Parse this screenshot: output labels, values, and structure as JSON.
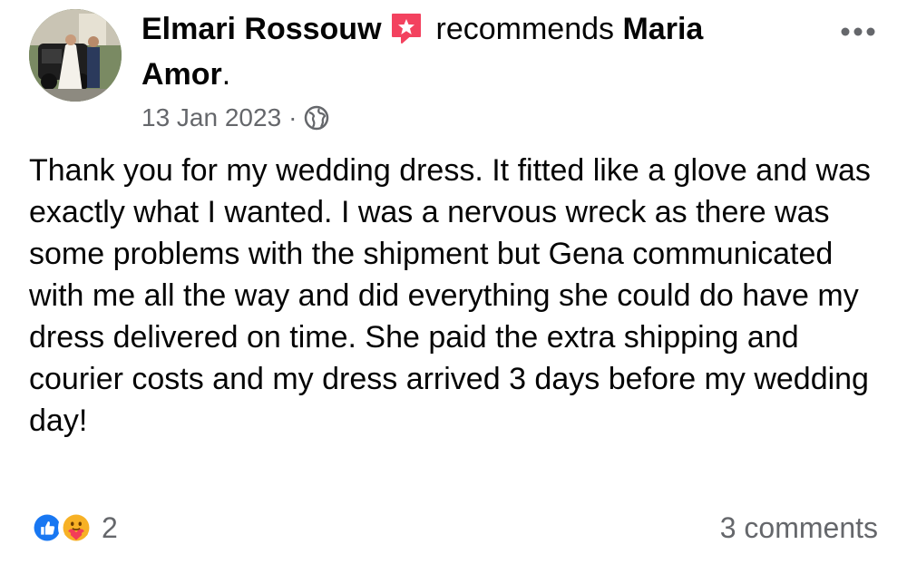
{
  "post": {
    "author": "Elmari Rossouw",
    "action": "recommends",
    "page_name_part1": "Maria",
    "page_name_part2": "Amor",
    "page_name_suffix": ".",
    "date": "13 Jan 2023",
    "separator": "·",
    "audience_icon": "globe-icon",
    "badge_icon": "recommendation-star-icon",
    "badge_color": "#f3425f",
    "body": "Thank you for my wedding dress. It fitted like a glove and was exactly what I wanted. I was a nervous wreck as there was some problems with the shipment but Gena communicated with me all the way and did everything she could do have my dress delivered on time. She paid the extra shipping and courier costs and my dress arrived 3 days before my wedding day!",
    "reactions": {
      "icons": [
        "like-icon",
        "care-icon"
      ],
      "count": "2",
      "like_color": "#1877f2"
    },
    "comments_label": "3 comments"
  }
}
